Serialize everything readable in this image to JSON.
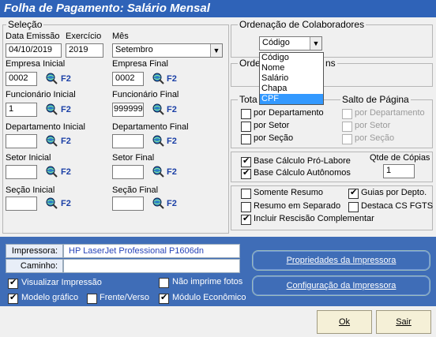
{
  "title": "Folha de Pagamento: Salário Mensal",
  "selecao": {
    "title": "Seleção",
    "data_emissao_label": "Data Emissão",
    "data_emissao": "04/10/2019",
    "exercicio_label": "Exercício",
    "exercicio": "2019",
    "mes_label": "Mês",
    "mes": "Setembro",
    "f2": "F2",
    "empresa_inicial_label": "Empresa Inicial",
    "empresa_inicial": "0002",
    "empresa_final_label": "Empresa Final",
    "empresa_final": "0002",
    "funcionario_inicial_label": "Funcionário Inicial",
    "funcionario_inicial": "1",
    "funcionario_final_label": "Funcionário Final",
    "funcionario_final": "999999",
    "departamento_inicial_label": "Departamento Inicial",
    "departamento_final_label": "Departamento Final",
    "setor_inicial_label": "Setor Inicial",
    "setor_final_label": "Setor Final",
    "secao_inicial_label": "Seção Inicial",
    "secao_final_label": "Seção Final"
  },
  "ordenacao": {
    "title": "Ordenação de Colaboradores",
    "selected": "Código",
    "options": [
      "Código",
      "Nome",
      "Salário",
      "Chapa",
      "CPF"
    ],
    "highlighted": "CPF",
    "second_title_visible": "Orde",
    "second_title_tail": "ns"
  },
  "totais": {
    "title": "Tota",
    "por_departamento": "por Departamento",
    "por_setor": "por Setor",
    "por_secao": "por Seção"
  },
  "salto": {
    "title": "Salto de Página",
    "por_departamento": "por Departamento",
    "por_setor": "por Setor",
    "por_secao": "por Seção"
  },
  "calculo": {
    "pro_labore": "Base Cálculo Pró-Labore",
    "autonomos": "Base Cálculo Autônomos",
    "qtde_copias_label": "Qtde de Cópias",
    "qtde_copias": "1"
  },
  "opcoes": {
    "somente_resumo": "Somente Resumo",
    "guias_por_depto": "Guias por Depto.",
    "resumo_separado": "Resumo em Separado",
    "destaca_cs_fgts": "Destaca CS FGTS",
    "incluir_rescisao": "Incluir Rescisão Complementar"
  },
  "impressao": {
    "impressora_label": "Impressora:",
    "impressora": "HP LaserJet Professional P1606dn",
    "caminho_label": "Caminho:",
    "caminho": "",
    "propriedades_btn": "Propriedades da Impressora",
    "configuracao_btn": "Configuração da Impressora",
    "visualizar": "Visualizar Impressão",
    "nao_imprime_fotos": "Não imprime fotos",
    "modelo_grafico": "Modelo gráfico",
    "frente_verso": "Frente/Verso",
    "modulo_economico": "Módulo Econômico"
  },
  "buttons": {
    "ok": "Ok",
    "sair": "Sair"
  }
}
